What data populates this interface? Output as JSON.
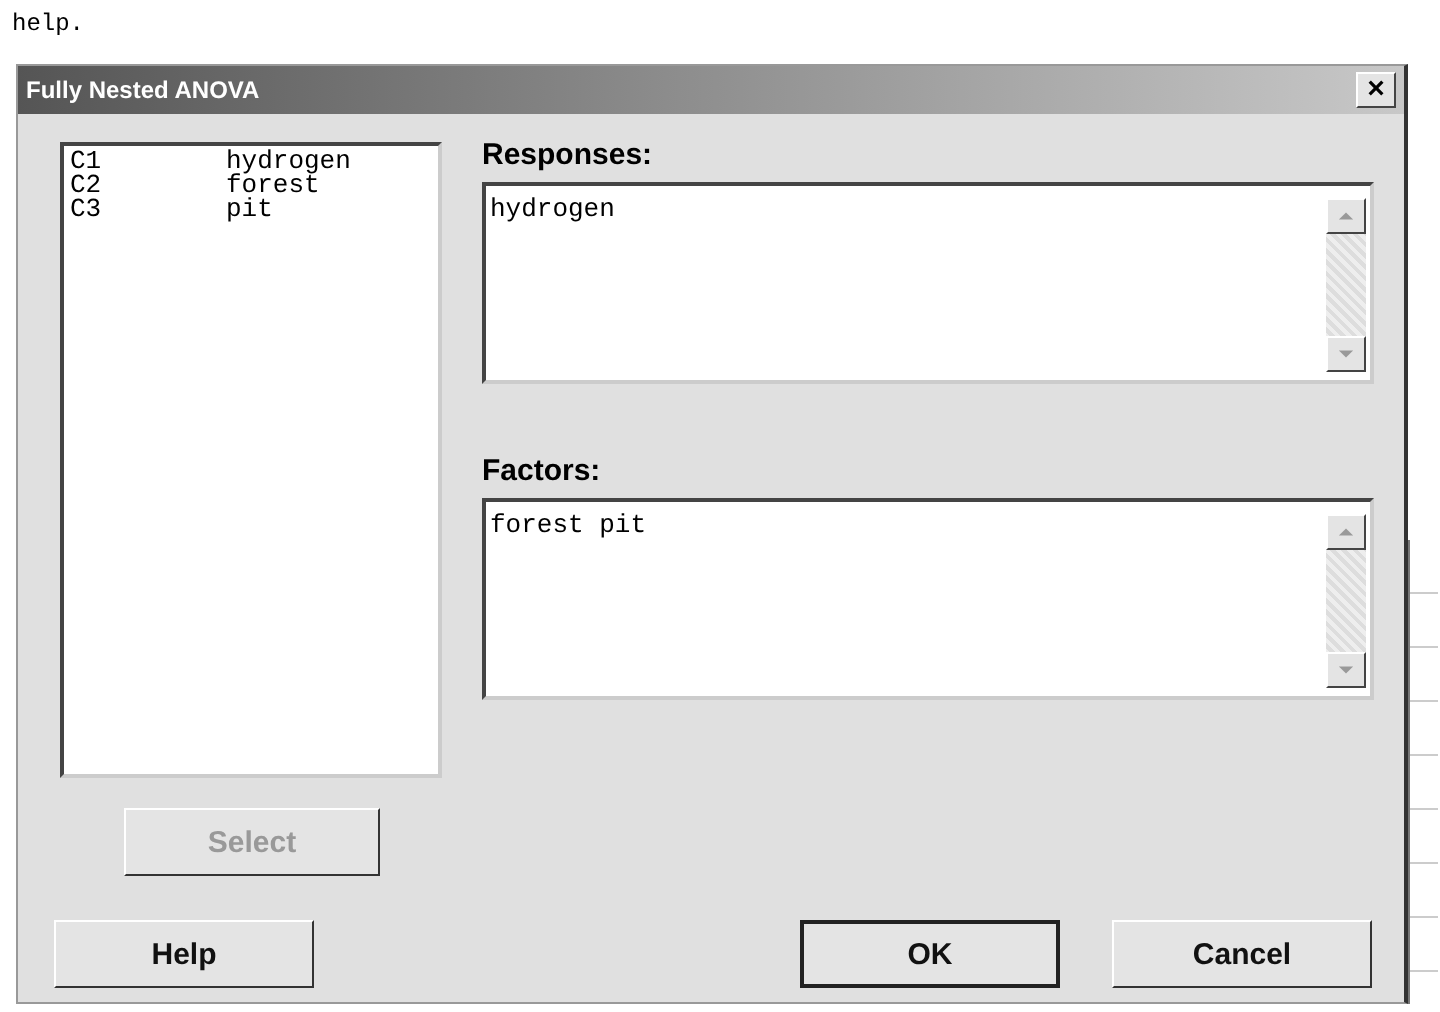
{
  "background_text": "help.",
  "window": {
    "title": "Fully Nested ANOVA",
    "close": "×"
  },
  "variables": [
    {
      "column": "C1",
      "name": "hydrogen"
    },
    {
      "column": "C2",
      "name": "forest"
    },
    {
      "column": "C3",
      "name": "pit"
    }
  ],
  "responses": {
    "label": "Responses:",
    "value": "hydrogen"
  },
  "factors": {
    "label": "Factors:",
    "value": "forest pit"
  },
  "select_button": {
    "label": "Select",
    "disabled": true
  },
  "buttons": [
    {
      "label": "Help",
      "default": false
    },
    {
      "label": "OK",
      "default": true
    },
    {
      "label": "Cancel",
      "default": false
    }
  ]
}
